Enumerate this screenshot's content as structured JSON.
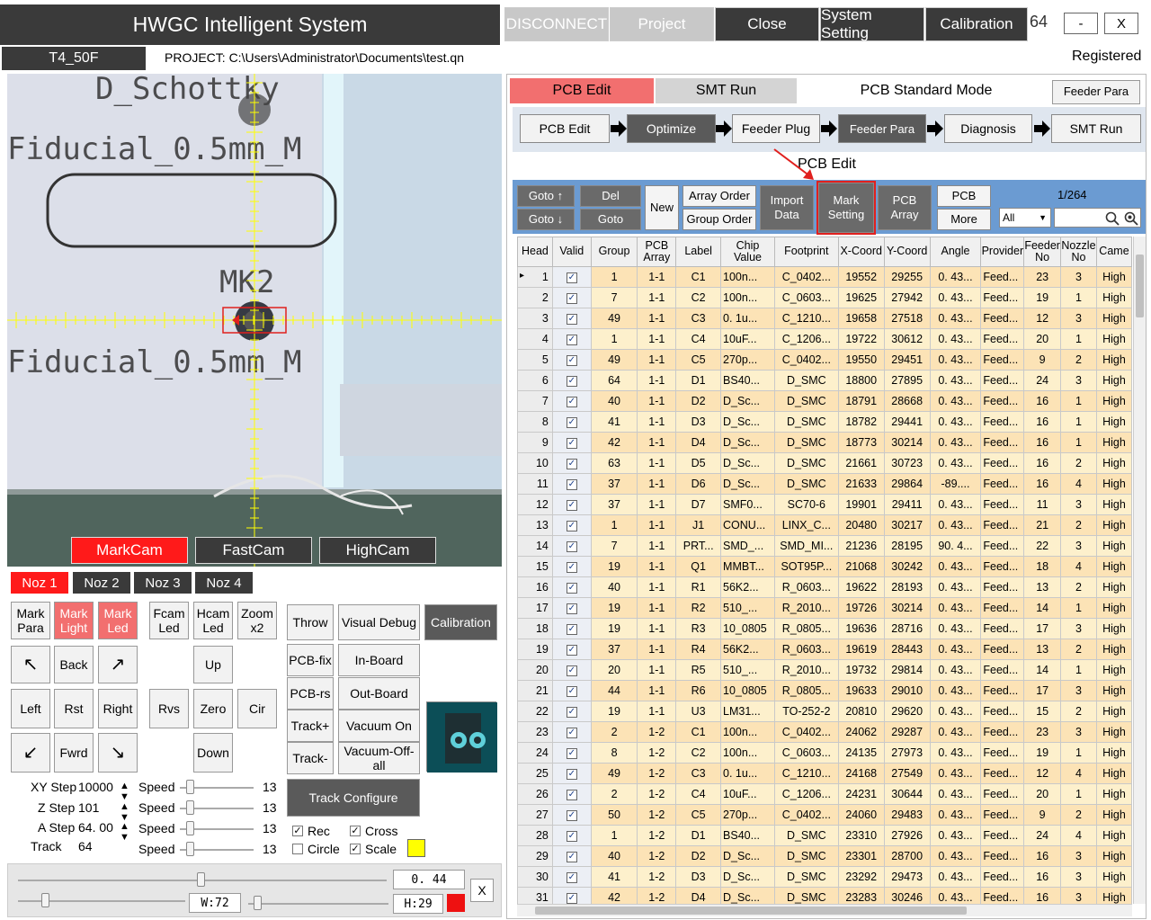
{
  "window": {
    "title": "HWGC Intelligent System",
    "buttons": [
      "DISCONNECT",
      "Project",
      "Close",
      "System Setting",
      "Calibration"
    ],
    "counter": "64",
    "minimize": "-",
    "close": "X"
  },
  "info": {
    "model": "T4_50F",
    "project": "PROJECT: C:\\Users\\Administrator\\Documents\\test.qn",
    "registered": "Registered"
  },
  "camera": {
    "overlay_text": [
      "D_Schottky",
      "Fiducial_0.5mm_M",
      "MK2",
      "Fiducial_0.5mm_M"
    ],
    "tabs": [
      "MarkCam",
      "FastCam",
      "HighCam"
    ],
    "nozzles": [
      "Noz 1",
      "Noz 2",
      "Noz 3",
      "Noz 4"
    ]
  },
  "controls": {
    "mark_para": "Mark\nPara",
    "mark_light": "Mark\nLight",
    "mark_led": "Mark\nLed",
    "fcam_led": "Fcam\nLed",
    "hcam_led": "Hcam\nLed",
    "zoom": "Zoom\nx2",
    "throw": "Throw",
    "visual_debug": "Visual Debug",
    "calibration": "Calibration",
    "back": "Back",
    "up": "Up",
    "left": "Left",
    "rst": "Rst",
    "right": "Right",
    "rvs": "Rvs",
    "zero": "Zero",
    "cir": "Cir",
    "fwrd": "Fwrd",
    "down": "Down",
    "pcb_fix": "PCB-fix",
    "in_board": "In-Board",
    "pcb_rs": "PCB-rs",
    "out_board": "Out-Board",
    "track_plus": "Track+",
    "vacuum_on": "Vacuum On",
    "track_minus": "Track-",
    "vacuum_off": "Vacuum-Off-all",
    "track_configure": "Track Configure",
    "xy_step_label": "XY Step",
    "xy_step": "10000",
    "z_step_label": "Z Step",
    "z_step": "101",
    "a_step_label": "A Step",
    "a_step": "64. 00",
    "track_label": "Track",
    "track": "64",
    "speed_label": "Speed",
    "speed_value": "13",
    "rec": "Rec",
    "cross": "Cross",
    "circle": "Circle",
    "scale": "Scale",
    "value_box": "0. 44",
    "w_box": "W:72",
    "h_box": "H:29",
    "x_button": "X"
  },
  "right": {
    "tab_pcb_edit": "PCB Edit",
    "tab_smt_run": "SMT Run",
    "mode": "PCB Standard Mode",
    "feeder_para_btn": "Feeder Para",
    "flow": [
      "PCB Edit",
      "Optimize",
      "Feeder Plug",
      "Feeder Para",
      "Diagnosis",
      "SMT Run"
    ],
    "section_title": "PCB Edit",
    "toolbar": {
      "goto_up": "Goto ↑",
      "goto_down": "Goto ↓",
      "del": "Del",
      "goto": "Goto",
      "new": "New",
      "array_order": "Array Order",
      "group_order": "Group Order",
      "import_data": "Import\nData",
      "mark_setting": "Mark\nSetting",
      "pcb_array": "PCB\nArray",
      "pcb": "PCB",
      "more": "More",
      "page": "1/264",
      "filter": "All"
    },
    "columns": [
      "Head",
      "Valid",
      "Group",
      "PCB\nArray",
      "Label",
      "Chip\nValue",
      "Footprint",
      "X-Coord",
      "Y-Coord",
      "Angle",
      "Provider",
      "Feeder\nNo",
      "Nozzle\nNo",
      "Came"
    ],
    "rows": [
      [
        "1",
        "1",
        "1-1",
        "C1",
        "100n...",
        "C_0402...",
        "19552",
        "29255",
        "0. 43...",
        "Feed...",
        "23",
        "3",
        "High"
      ],
      [
        "2",
        "7",
        "1-1",
        "C2",
        "100n...",
        "C_0603...",
        "19625",
        "27942",
        "0. 43...",
        "Feed...",
        "19",
        "1",
        "High"
      ],
      [
        "3",
        "49",
        "1-1",
        "C3",
        "0. 1u...",
        "C_1210...",
        "19658",
        "27518",
        "0. 43...",
        "Feed...",
        "12",
        "3",
        "High"
      ],
      [
        "4",
        "1",
        "1-1",
        "C4",
        "10uF...",
        "C_1206...",
        "19722",
        "30612",
        "0. 43...",
        "Feed...",
        "20",
        "1",
        "High"
      ],
      [
        "5",
        "49",
        "1-1",
        "C5",
        "270p...",
        "C_0402...",
        "19550",
        "29451",
        "0. 43...",
        "Feed...",
        "9",
        "2",
        "High"
      ],
      [
        "6",
        "64",
        "1-1",
        "D1",
        "BS40...",
        "D_SMC",
        "18800",
        "27895",
        "0. 43...",
        "Feed...",
        "24",
        "3",
        "High"
      ],
      [
        "7",
        "40",
        "1-1",
        "D2",
        "D_Sc...",
        "D_SMC",
        "18791",
        "28668",
        "0. 43...",
        "Feed...",
        "16",
        "1",
        "High"
      ],
      [
        "8",
        "41",
        "1-1",
        "D3",
        "D_Sc...",
        "D_SMC",
        "18782",
        "29441",
        "0. 43...",
        "Feed...",
        "16",
        "1",
        "High"
      ],
      [
        "9",
        "42",
        "1-1",
        "D4",
        "D_Sc...",
        "D_SMC",
        "18773",
        "30214",
        "0. 43...",
        "Feed...",
        "16",
        "1",
        "High"
      ],
      [
        "10",
        "63",
        "1-1",
        "D5",
        "D_Sc...",
        "D_SMC",
        "21661",
        "30723",
        "0. 43...",
        "Feed...",
        "16",
        "2",
        "High"
      ],
      [
        "11",
        "37",
        "1-1",
        "D6",
        "D_Sc...",
        "D_SMC",
        "21633",
        "29864",
        "-89....",
        "Feed...",
        "16",
        "4",
        "High"
      ],
      [
        "12",
        "37",
        "1-1",
        "D7",
        "SMF0...",
        "SC70-6",
        "19901",
        "29411",
        "0. 43...",
        "Feed...",
        "11",
        "3",
        "High"
      ],
      [
        "13",
        "1",
        "1-1",
        "J1",
        "CONU...",
        "LINX_C...",
        "20480",
        "30217",
        "0. 43...",
        "Feed...",
        "21",
        "2",
        "High"
      ],
      [
        "14",
        "7",
        "1-1",
        "PRT...",
        "SMD_...",
        "SMD_MI...",
        "21236",
        "28195",
        "90. 4...",
        "Feed...",
        "22",
        "3",
        "High"
      ],
      [
        "15",
        "19",
        "1-1",
        "Q1",
        "MMBT...",
        "SOT95P...",
        "21068",
        "30242",
        "0. 43...",
        "Feed...",
        "18",
        "4",
        "High"
      ],
      [
        "16",
        "40",
        "1-1",
        "R1",
        "56K2...",
        "R_0603...",
        "19622",
        "28193",
        "0. 43...",
        "Feed...",
        "13",
        "2",
        "High"
      ],
      [
        "17",
        "19",
        "1-1",
        "R2",
        "510_...",
        "R_2010...",
        "19726",
        "30214",
        "0. 43...",
        "Feed...",
        "14",
        "1",
        "High"
      ],
      [
        "18",
        "19",
        "1-1",
        "R3",
        "10_0805",
        "R_0805...",
        "19636",
        "28716",
        "0. 43...",
        "Feed...",
        "17",
        "3",
        "High"
      ],
      [
        "19",
        "37",
        "1-1",
        "R4",
        "56K2...",
        "R_0603...",
        "19619",
        "28443",
        "0. 43...",
        "Feed...",
        "13",
        "2",
        "High"
      ],
      [
        "20",
        "20",
        "1-1",
        "R5",
        "510_...",
        "R_2010...",
        "19732",
        "29814",
        "0. 43...",
        "Feed...",
        "14",
        "1",
        "High"
      ],
      [
        "21",
        "44",
        "1-1",
        "R6",
        "10_0805",
        "R_0805...",
        "19633",
        "29010",
        "0. 43...",
        "Feed...",
        "17",
        "3",
        "High"
      ],
      [
        "22",
        "19",
        "1-1",
        "U3",
        "LM31...",
        "TO-252-2",
        "20810",
        "29620",
        "0. 43...",
        "Feed...",
        "15",
        "2",
        "High"
      ],
      [
        "23",
        "2",
        "1-2",
        "C1",
        "100n...",
        "C_0402...",
        "24062",
        "29287",
        "0. 43...",
        "Feed...",
        "23",
        "3",
        "High"
      ],
      [
        "24",
        "8",
        "1-2",
        "C2",
        "100n...",
        "C_0603...",
        "24135",
        "27973",
        "0. 43...",
        "Feed...",
        "19",
        "1",
        "High"
      ],
      [
        "25",
        "49",
        "1-2",
        "C3",
        "0. 1u...",
        "C_1210...",
        "24168",
        "27549",
        "0. 43...",
        "Feed...",
        "12",
        "4",
        "High"
      ],
      [
        "26",
        "2",
        "1-2",
        "C4",
        "10uF...",
        "C_1206...",
        "24231",
        "30644",
        "0. 43...",
        "Feed...",
        "20",
        "1",
        "High"
      ],
      [
        "27",
        "50",
        "1-2",
        "C5",
        "270p...",
        "C_0402...",
        "24060",
        "29483",
        "0. 43...",
        "Feed...",
        "9",
        "2",
        "High"
      ],
      [
        "28",
        "1",
        "1-2",
        "D1",
        "BS40...",
        "D_SMC",
        "23310",
        "27926",
        "0. 43...",
        "Feed...",
        "24",
        "4",
        "High"
      ],
      [
        "29",
        "40",
        "1-2",
        "D2",
        "D_Sc...",
        "D_SMC",
        "23301",
        "28700",
        "0. 43...",
        "Feed...",
        "16",
        "3",
        "High"
      ],
      [
        "30",
        "41",
        "1-2",
        "D3",
        "D_Sc...",
        "D_SMC",
        "23292",
        "29473",
        "0. 43...",
        "Feed...",
        "16",
        "3",
        "High"
      ],
      [
        "31",
        "42",
        "1-2",
        "D4",
        "D_Sc...",
        "D_SMC",
        "23283",
        "30246",
        "0. 43...",
        "Feed...",
        "16",
        "3",
        "High"
      ]
    ]
  },
  "colors": {
    "dark": "#3a3a3a",
    "active_red": "#ff1a1a",
    "pink": "#f26f6f",
    "toolbar_blue": "#6b9bd2",
    "row_odd": "#fce3b6",
    "row_even": "#fdf0cc",
    "crosshair": "#ffff00",
    "highlight": "#e0201e"
  }
}
